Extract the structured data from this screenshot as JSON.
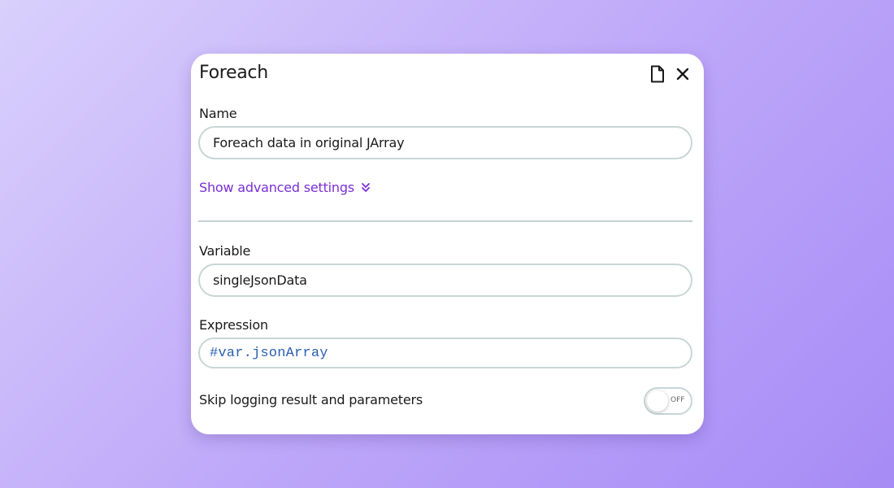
{
  "panel": {
    "title": "Foreach",
    "icons": {
      "document": "document-icon",
      "close": "close-icon"
    }
  },
  "fields": {
    "name": {
      "label": "Name",
      "value": "Foreach data in original JArray"
    },
    "variable": {
      "label": "Variable",
      "value": "singleJsonData"
    },
    "expression": {
      "label": "Expression",
      "value": "#var.jsonArray"
    }
  },
  "advanced": {
    "label": "Show advanced settings",
    "icon": "double-chevron-down-icon"
  },
  "skip_logging": {
    "label": "Skip logging result and parameters",
    "toggle_state": "OFF"
  },
  "colors": {
    "accent": "#7a2fd6",
    "code": "#2a5fb0",
    "field_border": "#c8d6d6"
  }
}
